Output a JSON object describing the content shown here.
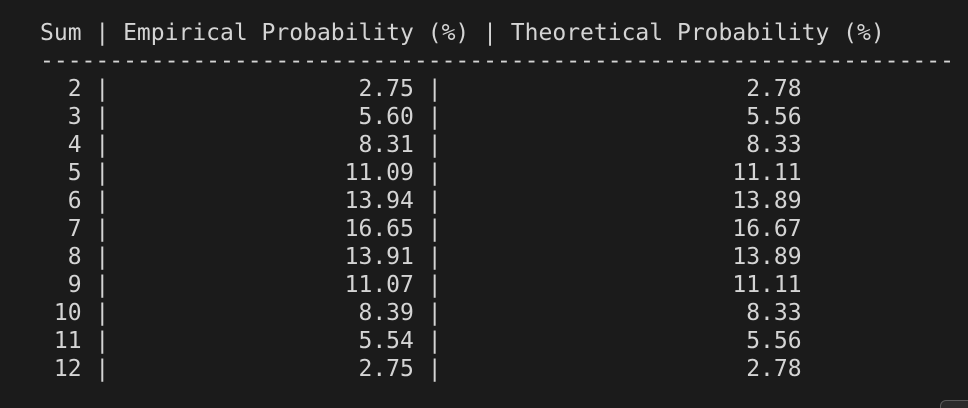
{
  "terminal": {
    "header": "Sum | Empirical Probability (%) | Theoretical Probability (%)",
    "separator": "------------------------------------------------------------------",
    "rows": [
      "  2 |                  2.75 |                      2.78",
      "  3 |                  5.60 |                      5.56",
      "  4 |                  8.31 |                      8.33",
      "  5 |                 11.09 |                     11.11",
      "  6 |                 13.94 |                     13.89",
      "  7 |                 16.65 |                     16.67",
      "  8 |                 13.91 |                     13.89",
      "  9 |                 11.07 |                     11.11",
      " 10 |                  8.39 |                      8.33",
      " 11 |                  5.54 |                      5.56",
      " 12 |                  2.75 |                      2.78"
    ]
  }
}
